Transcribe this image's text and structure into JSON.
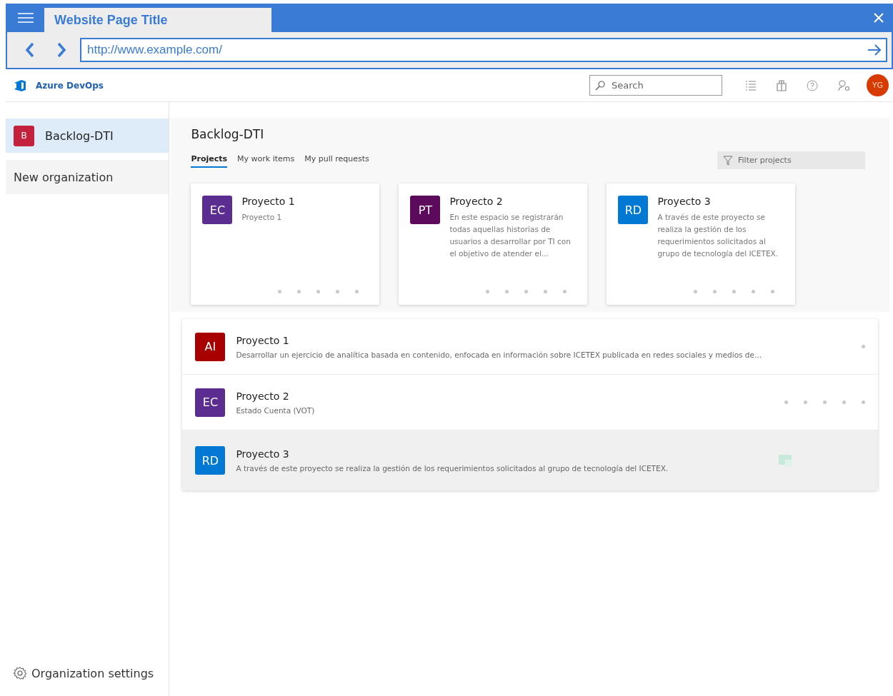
{
  "window": {
    "title": "Website Page Title",
    "url": "http://www.example.com/"
  },
  "header": {
    "product": "Azure DevOps",
    "search": {
      "placeholder": "Search"
    },
    "avatar": "YG"
  },
  "sidebar": {
    "items": [
      {
        "initial": "B",
        "label": "Backlog-DTI",
        "selected": true,
        "color": "#c4213f"
      },
      {
        "label": "New organization",
        "selected": false
      }
    ],
    "footer": "Organization settings"
  },
  "main": {
    "title": "Backlog-DTI",
    "tabs": [
      {
        "label": "Projects",
        "selected": true
      },
      {
        "label": "My work items",
        "selected": false
      },
      {
        "label": "My pull requests",
        "selected": false
      }
    ],
    "filter": {
      "placeholder": "Filter projects"
    },
    "cards": [
      {
        "initials": "EC",
        "color": "#5c2d91",
        "name": "Proyecto 1",
        "description": "Proyecto 1"
      },
      {
        "initials": "PT",
        "color": "#5c0a5c",
        "name": "Proyecto 2",
        "description": "En este espacio se registrarán todas aquellas historias de usuarios a desarrollar por TI con el objetivo de atender el..."
      },
      {
        "initials": "RD",
        "color": "#0078d4",
        "name": "Proyecto 3",
        "description": "A través de este proyecto se realiza la gestión de los requerimientos solicitados al grupo de tecnología del ICETEX."
      }
    ],
    "rows": [
      {
        "initials": "AI",
        "color": "#a80000",
        "name": "Proyecto 1",
        "description": "Desarrollar un ejercicio de analítica basada en contenido, enfocada en información sobre ICETEX publicada en redes sociales y medios de...",
        "kind": "dot",
        "highlighted": false
      },
      {
        "initials": "EC",
        "color": "#5c2d91",
        "name": "Proyecto 2",
        "description": "Estado Cuenta (VOT)",
        "kind": "dots",
        "highlighted": false
      },
      {
        "initials": "RD",
        "color": "#0078d4",
        "name": "Proyecto 3",
        "description": "A través de este proyecto se realiza la gestión de los requerimientos solicitados al grupo de tecnología del ICETEX.",
        "kind": "icon",
        "highlighted": true
      }
    ]
  }
}
